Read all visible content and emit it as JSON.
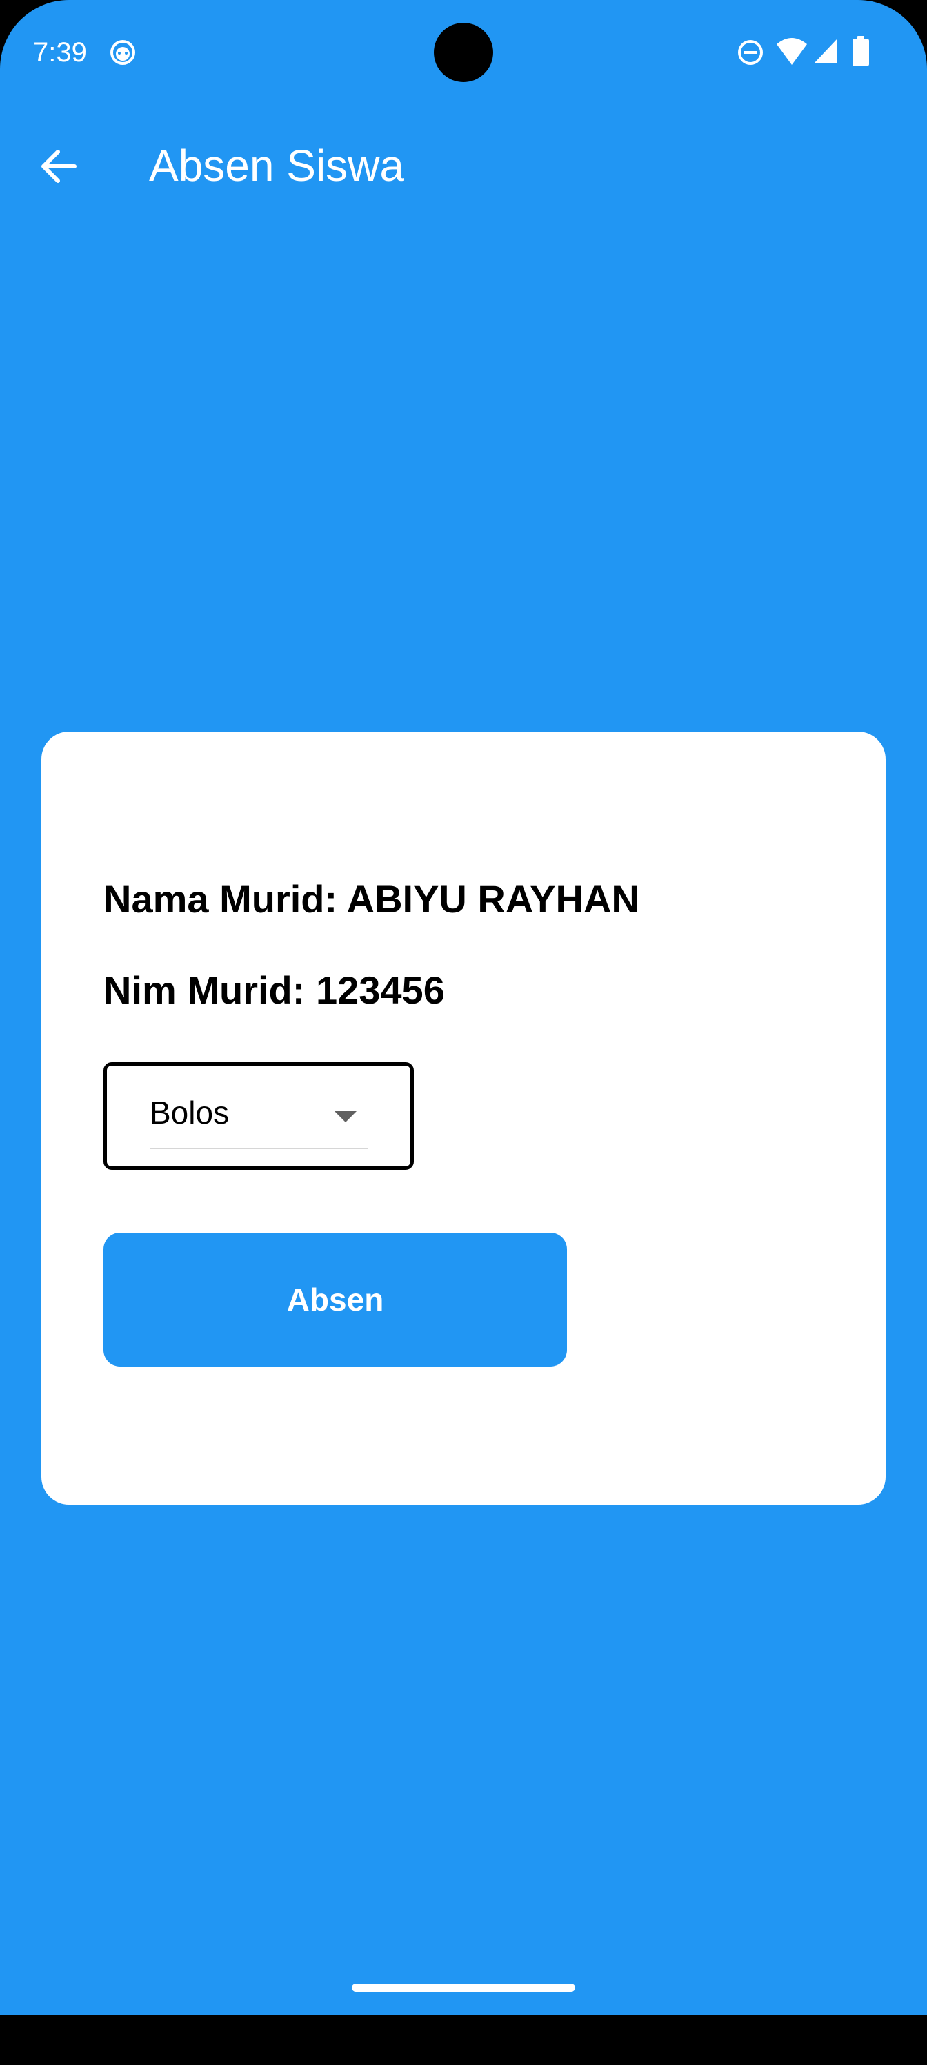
{
  "status_bar": {
    "time": "7:39",
    "app_icon": "android-debug-icon",
    "icons": [
      "do-not-disturb-icon",
      "wifi-icon",
      "cell-signal-icon",
      "battery-icon"
    ]
  },
  "app_bar": {
    "back_icon": "arrow-back-icon",
    "title": "Absen Siswa"
  },
  "card": {
    "name_line": "Nama Murid: ABIYU RAYHAN",
    "nim_line": "Nim Murid: 123456",
    "status_dropdown": {
      "selected": "Bolos"
    },
    "submit_label": "Absen"
  },
  "colors": {
    "primary": "#2196F3",
    "card": "#FFFFFF",
    "text": "#000000"
  }
}
